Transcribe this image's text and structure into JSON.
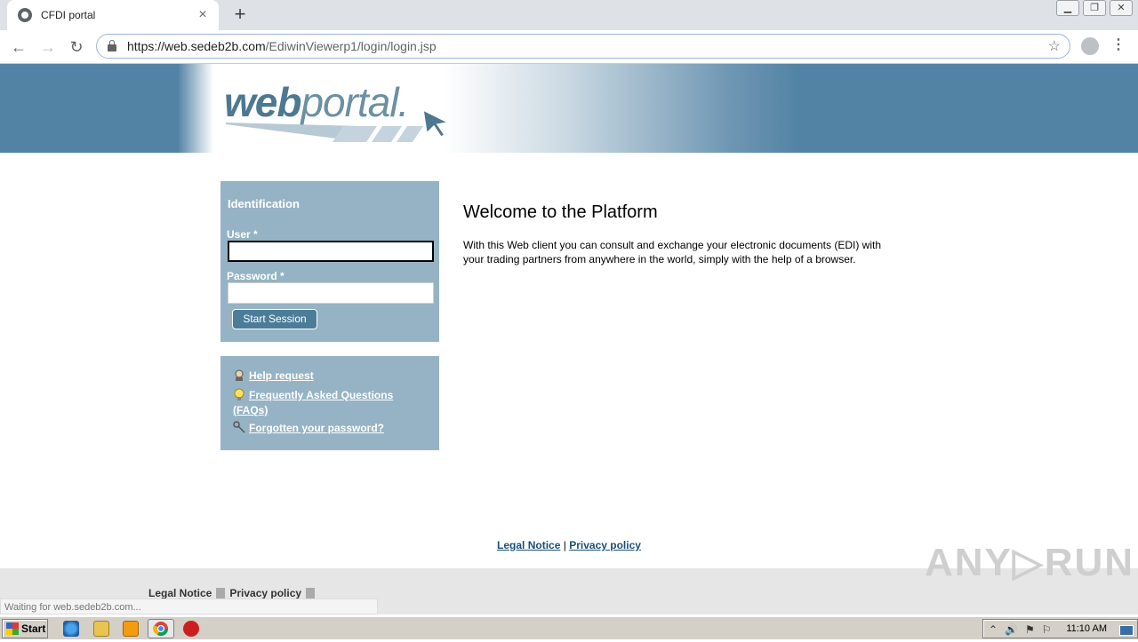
{
  "browser": {
    "tab_title": "CFDI portal",
    "tab_close": "×",
    "new_tab": "+",
    "url_host": "https://web.sedeb2b.com",
    "url_path": "/EdiwinViewerp1/login/login.jsp"
  },
  "brand": {
    "web": "web",
    "portal": "portal."
  },
  "login": {
    "heading": "Identification",
    "user_label": "User *",
    "user_value": "",
    "password_label": "Password *",
    "password_value": "",
    "submit_label": "Start Session"
  },
  "help_links": [
    {
      "label": "Help request"
    },
    {
      "label": "Frequently Asked Questions (FAQs)"
    },
    {
      "label": "Forgotten your password?"
    }
  ],
  "welcome": {
    "title": "Welcome to the Platform",
    "text": "With this Web client you can consult and exchange your electronic documents (EDI) with your trading partners from anywhere in the world, simply with the help of a browser."
  },
  "footer": {
    "legal": "Legal Notice",
    "separator": "|",
    "privacy": "Privacy policy"
  },
  "bottom_bar": {
    "legal": "Legal Notice",
    "privacy": "Privacy policy"
  },
  "status_text": "Waiting for web.sedeb2b.com...",
  "watermark": "ANY▷RUN",
  "taskbar": {
    "start_label": "Start",
    "clock": "11:10 AM"
  },
  "colors": {
    "banner_blue": "#5283a4",
    "panel_blue": "#95b3c4",
    "button_blue": "#4b7d99",
    "link_blue": "#1b4f78"
  }
}
